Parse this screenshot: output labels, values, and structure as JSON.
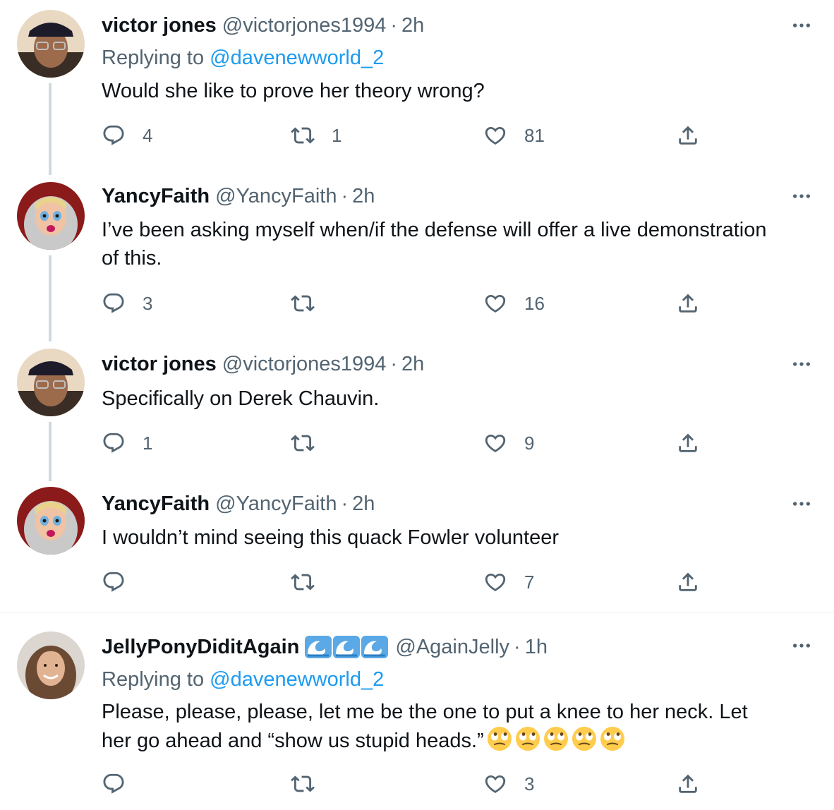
{
  "colors": {
    "accent": "#1d9bf0",
    "secondary_text": "#536471",
    "thread_line": "#cfd9de"
  },
  "tweets": [
    {
      "name": "victor jones",
      "handle": "@victorjones1994",
      "dot": "·",
      "time": "2h",
      "replying_prefix": "Replying to",
      "replying_to": "@davenewworld_2",
      "lines": [
        "Would she like to prove her theory wrong?"
      ],
      "replies": "4",
      "retweets": "1",
      "likes": "81"
    },
    {
      "name": "YancyFaith",
      "handle": "@YancyFaith",
      "dot": "·",
      "time": "2h",
      "lines": [
        "I’ve been asking myself when/if the defense will offer a live demonstration",
        "of this."
      ],
      "replies": "3",
      "retweets": "",
      "likes": "16"
    },
    {
      "name": "victor jones",
      "handle": "@victorjones1994",
      "dot": "·",
      "time": "2h",
      "lines": [
        "Specifically on Derek Chauvin."
      ],
      "replies": "1",
      "retweets": "",
      "likes": "9"
    },
    {
      "name": "YancyFaith",
      "handle": "@YancyFaith",
      "dot": "·",
      "time": "2h",
      "lines": [
        "I wouldn’t mind seeing this quack Fowler volunteer"
      ],
      "replies": "",
      "retweets": "",
      "likes": "7"
    },
    {
      "name": "JellyPonyDiditAgain",
      "name_emoji": [
        "wave-emoji",
        "wave-emoji",
        "wave-emoji"
      ],
      "handle": "@AgainJelly",
      "dot": "·",
      "time": "1h",
      "replying_prefix": "Replying to",
      "replying_to": "@davenewworld_2",
      "lines": [
        "Please, please, please, let me be the one to put a knee to her neck. Let",
        "her go ahead and “show us stupid heads.”"
      ],
      "text_emoji": [
        "eye-roll-emoji",
        "eye-roll-emoji",
        "eye-roll-emoji",
        "eye-roll-emoji",
        "eye-roll-emoji"
      ],
      "replies": "",
      "retweets": "",
      "likes": "3"
    }
  ],
  "icons": {
    "reply": "reply-icon",
    "retweet": "retweet-icon",
    "like": "heart-icon",
    "share": "share-icon",
    "more": "more-icon"
  }
}
